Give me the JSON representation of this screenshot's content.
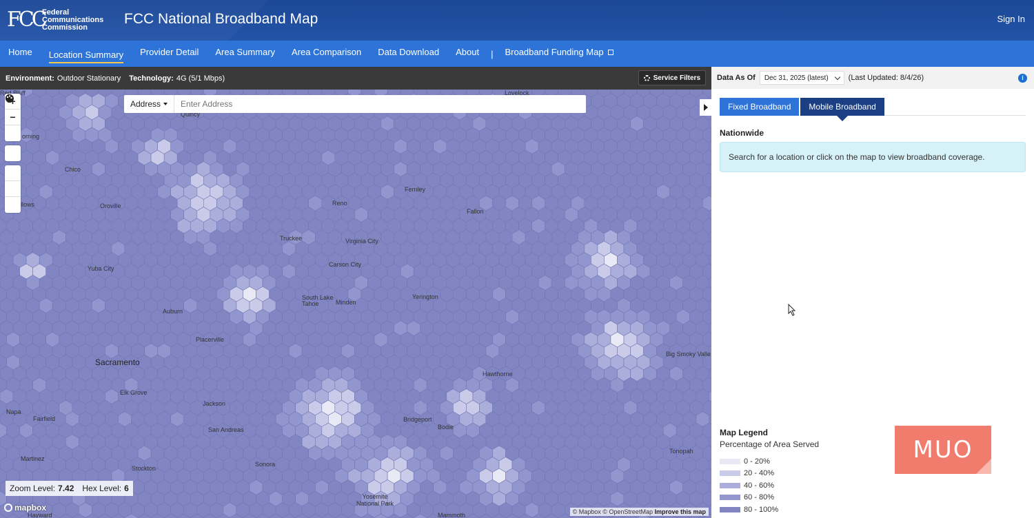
{
  "header": {
    "logo_mark": "FCC",
    "logo_lines": [
      "Federal",
      "Communications",
      "Commission"
    ],
    "title": "FCC National Broadband Map",
    "signin": "Sign In"
  },
  "nav": {
    "items": [
      "Home",
      "Location Summary",
      "Provider Detail",
      "Area Summary",
      "Area Comparison",
      "Data Download",
      "About"
    ],
    "active": "Location Summary",
    "separator": "|",
    "external_item": "Broadband Funding Map"
  },
  "toolbar": {
    "environment_label": "Environment:",
    "environment_value": "Outdoor Stationary",
    "technology_label": "Technology:",
    "technology_value": "4G (5/1 Mbps)",
    "service_filters": "Service Filters"
  },
  "search": {
    "type_label": "Address",
    "placeholder": "Enter Address"
  },
  "map": {
    "places": [
      {
        "name": "Red Bluff"
      },
      {
        "name": "Lovelock"
      },
      {
        "name": "orning"
      },
      {
        "name": "Quincy"
      },
      {
        "name": "Chico"
      },
      {
        "name": "Fernley"
      },
      {
        "name": "Oroville"
      },
      {
        "name": "Reno"
      },
      {
        "name": "illows"
      },
      {
        "name": "Fallon"
      },
      {
        "name": "Truckee"
      },
      {
        "name": "Virginia City"
      },
      {
        "name": "Carson City"
      },
      {
        "name": "Yuba City"
      },
      {
        "name": "South Lake Tahoe"
      },
      {
        "name": "Minden"
      },
      {
        "name": "Yerington"
      },
      {
        "name": "Auburn"
      },
      {
        "name": "Placerville"
      },
      {
        "name": "Big Smoky Valle"
      },
      {
        "name": "Sacramento"
      },
      {
        "name": "Hawthorne"
      },
      {
        "name": "Elk Grove"
      },
      {
        "name": "Jackson"
      },
      {
        "name": "Napa"
      },
      {
        "name": "Fairfield"
      },
      {
        "name": "Bridgeport"
      },
      {
        "name": "Bodie"
      },
      {
        "name": "San Andreas"
      },
      {
        "name": "Martinez"
      },
      {
        "name": "Tonopah"
      },
      {
        "name": "Stockton"
      },
      {
        "name": "Sonora"
      },
      {
        "name": "Yosemite National Park"
      },
      {
        "name": "Hayward"
      },
      {
        "name": "Mammoth"
      }
    ],
    "zoom_label": "Zoom Level:",
    "zoom_value": "7.42",
    "hex_label": "Hex Level:",
    "hex_value": "6",
    "mapbox": "mapbox",
    "attribution_mapbox": "© Mapbox",
    "attribution_osm": "© OpenStreetMap",
    "attribution_improve": "Improve this map"
  },
  "panel": {
    "data_as_of_label": "Data As Of",
    "date_value": "Dec 31, 2025 (latest)",
    "last_updated": "(Last Updated: 8/4/26)",
    "tabs": [
      "Fixed Broadband",
      "Mobile Broadband"
    ],
    "active_tab": "Mobile Broadband",
    "region": "Nationwide",
    "notice": "Search for a location or click on the map to view broadband coverage.",
    "legend_title": "Map Legend",
    "legend_subtitle": "Percentage of Area Served",
    "legend": [
      {
        "label": "0 - 20%",
        "color": "#e8e9f5"
      },
      {
        "label": "20 - 40%",
        "color": "#c9cbe8"
      },
      {
        "label": "40 - 60%",
        "color": "#abaedb"
      },
      {
        "label": "60 - 80%",
        "color": "#9196cf"
      },
      {
        "label": "80 - 100%",
        "color": "#8186c3"
      }
    ]
  },
  "watermark": "MUO"
}
